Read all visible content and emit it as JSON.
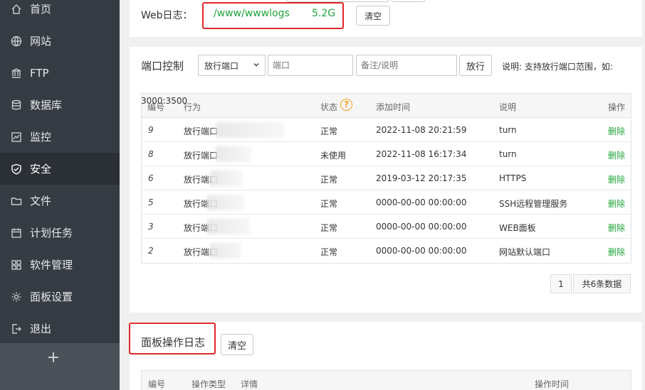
{
  "sidebar": {
    "items": [
      {
        "label": "首页",
        "icon": "home-icon"
      },
      {
        "label": "网站",
        "icon": "globe-icon"
      },
      {
        "label": "FTP",
        "icon": "ftp-icon"
      },
      {
        "label": "数据库",
        "icon": "database-icon"
      },
      {
        "label": "监控",
        "icon": "monitor-icon"
      },
      {
        "label": "安全",
        "icon": "shield-icon"
      },
      {
        "label": "文件",
        "icon": "folder-icon"
      },
      {
        "label": "计划任务",
        "icon": "calendar-icon"
      },
      {
        "label": "软件管理",
        "icon": "grid-icon"
      },
      {
        "label": "面板设置",
        "icon": "gear-icon"
      },
      {
        "label": "退出",
        "icon": "logout-icon"
      }
    ],
    "active": "安全",
    "add_label": "+"
  },
  "weblog": {
    "label": "Web日志：",
    "path": "/www/wwwlogs",
    "size": "5.2G",
    "clear_label": "清空"
  },
  "port_control": {
    "title": "端口控制",
    "select_value": "放行端口",
    "port_placeholder": "端口",
    "note_placeholder": "备注/说明",
    "allow_label": "放行",
    "hint": "说明: 支持放行端口范围，如:",
    "range_example": "3000:3500",
    "headers": [
      "编号",
      "行为",
      "状态",
      "添加时间",
      "说明",
      "操作"
    ],
    "rows": [
      {
        "id": "9",
        "action": "放行端口",
        "status": "正常",
        "time": "2022-11-08 20:21:59",
        "note": "turn",
        "op": "删除"
      },
      {
        "id": "8",
        "action": "放行端口",
        "status": "未使用",
        "time": "2022-11-08 16:17:34",
        "note": "turn",
        "op": "删除"
      },
      {
        "id": "6",
        "action": "放行端口",
        "status": "正常",
        "time": "2019-03-12 20:17:35",
        "note": "HTTPS",
        "op": "删除"
      },
      {
        "id": "5",
        "action": "放行端口",
        "status": "正常",
        "time": "0000-00-00 00:00:00",
        "note": "SSH远程管理服务",
        "op": "删除"
      },
      {
        "id": "3",
        "action": "放行端口",
        "status": "正常",
        "time": "0000-00-00 00:00:00",
        "note": "WEB面板",
        "op": "删除"
      },
      {
        "id": "2",
        "action": "放行端口",
        "status": "正常",
        "time": "0000-00-00 00:00:00",
        "note": "网站默认端口",
        "op": "删除"
      }
    ],
    "pager": {
      "page": "1",
      "total": "共6条数据"
    }
  },
  "panel_log": {
    "title": "面板操作日志",
    "clear_label": "清空",
    "headers": [
      "编号",
      "操作类型",
      "详情",
      "操作时间"
    ]
  },
  "colors": {
    "accent": "#20a53a",
    "highlight": "#e0282a",
    "sidebar": "#353c44"
  }
}
